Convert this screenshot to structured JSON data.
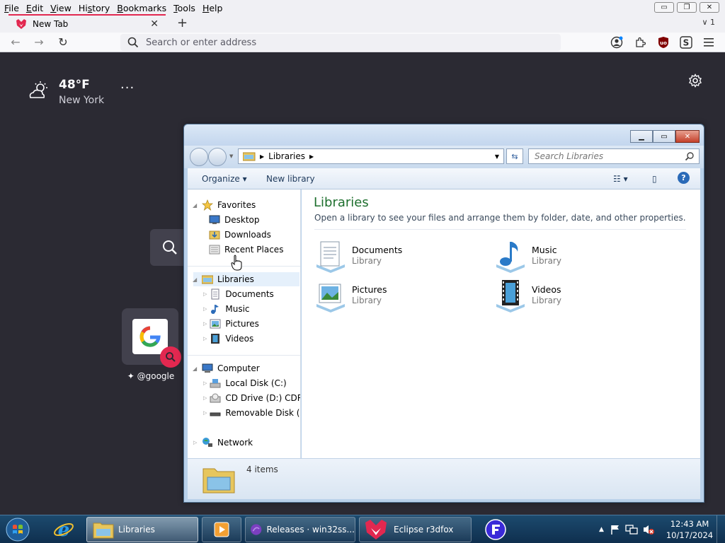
{
  "browser": {
    "menu": [
      {
        "pre": "",
        "key": "F",
        "post": "ile"
      },
      {
        "pre": "",
        "key": "E",
        "post": "dit"
      },
      {
        "pre": "",
        "key": "V",
        "post": "iew"
      },
      {
        "pre": "Hi",
        "key": "s",
        "post": "tory"
      },
      {
        "pre": "",
        "key": "B",
        "post": "ookmarks"
      },
      {
        "pre": "",
        "key": "T",
        "post": "ools"
      },
      {
        "pre": "",
        "key": "H",
        "post": "elp"
      }
    ],
    "tab_title": "New Tab",
    "url_placeholder": "Search or enter address",
    "accent_color": "#e22850"
  },
  "newtab": {
    "weather": {
      "temp": "48°F",
      "city": "New York",
      "icon": "partly-cloudy-icon"
    },
    "shortcut": {
      "label": "@google",
      "icon": "google-logo"
    }
  },
  "explorer": {
    "address_crumb": "Libraries",
    "search_placeholder": "Search Libraries",
    "toolbar": {
      "organize": "Organize",
      "new_library": "New library"
    },
    "nav": {
      "favorites": "Favorites",
      "favorites_items": [
        "Desktop",
        "Downloads",
        "Recent Places"
      ],
      "libraries": "Libraries",
      "libraries_items": [
        "Documents",
        "Music",
        "Pictures",
        "Videos"
      ],
      "computer": "Computer",
      "computer_items": [
        "Local Disk (C:)",
        "CD Drive (D:) CDROM",
        "Removable Disk (E:)"
      ],
      "network": "Network"
    },
    "main": {
      "title": "Libraries",
      "subtitle": "Open a library to see your files and arrange them by folder, date, and other properties.",
      "items": [
        {
          "name": "Documents",
          "type": "Library"
        },
        {
          "name": "Music",
          "type": "Library"
        },
        {
          "name": "Pictures",
          "type": "Library"
        },
        {
          "name": "Videos",
          "type": "Library"
        }
      ]
    },
    "status": "4 items"
  },
  "taskbar": {
    "items": [
      "Libraries",
      "Releases · win32ss...",
      "Eclipse r3dfox"
    ],
    "time": "12:43 AM",
    "date": "10/17/2024"
  }
}
